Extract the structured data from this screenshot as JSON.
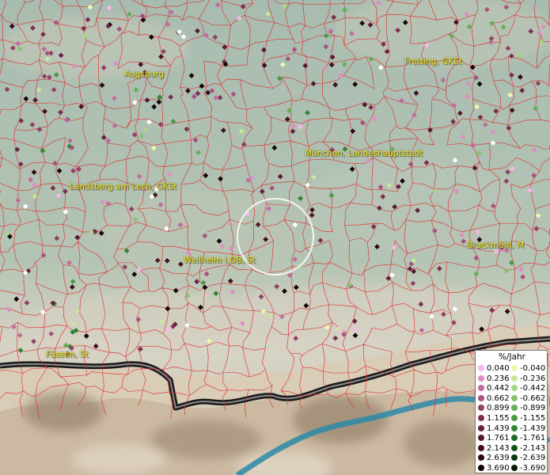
{
  "map": {
    "places": [
      {
        "name": "Augsburg"
      },
      {
        "name": "Freising, GKSt"
      },
      {
        "name": "München, Landeshauptstadt"
      },
      {
        "name": "Landsberg am Lech, GKSt"
      },
      {
        "name": "Weilheim i.OB, St"
      },
      {
        "name": "Bruckmühl, M"
      },
      {
        "name": "Füssen, St"
      }
    ],
    "legend": {
      "title": "%/Jahr",
      "positive": [
        {
          "label": "0.040",
          "color": "#f2b8e6"
        },
        {
          "label": "0.236",
          "color": "#dc8fc4"
        },
        {
          "label": "0.442",
          "color": "#c06c9e"
        },
        {
          "label": "0.662",
          "color": "#a9527f"
        },
        {
          "label": "0.899",
          "color": "#944067"
        },
        {
          "label": "1.155",
          "color": "#7d2f52"
        },
        {
          "label": "1.439",
          "color": "#692240"
        },
        {
          "label": "1.761",
          "color": "#561730"
        },
        {
          "label": "2.143",
          "color": "#420f22"
        },
        {
          "label": "2.639",
          "color": "#2e0816"
        },
        {
          "label": "3.690",
          "color": "#150308"
        }
      ],
      "negative": [
        {
          "label": "-0.040",
          "color": "#eef7b0"
        },
        {
          "label": "-0.236",
          "color": "#c9e69a"
        },
        {
          "label": "-0.442",
          "color": "#a8d588"
        },
        {
          "label": "-0.662",
          "color": "#86c272"
        },
        {
          "label": "-0.899",
          "color": "#66ad5a"
        },
        {
          "label": "-1.155",
          "color": "#4a9a47"
        },
        {
          "label": "-1.439",
          "color": "#338436"
        },
        {
          "label": "-1.761",
          "color": "#1f6c27"
        },
        {
          "label": "-2.143",
          "color": "#10541b"
        },
        {
          "label": "-2.639",
          "color": "#063a10"
        },
        {
          "label": "-3.690",
          "color": "#011c06"
        }
      ]
    },
    "colors": {
      "lowland": "#a9bfb3",
      "boundary": "#e02828",
      "label": "#e8e02a",
      "lake": "#2a8aa8"
    }
  }
}
